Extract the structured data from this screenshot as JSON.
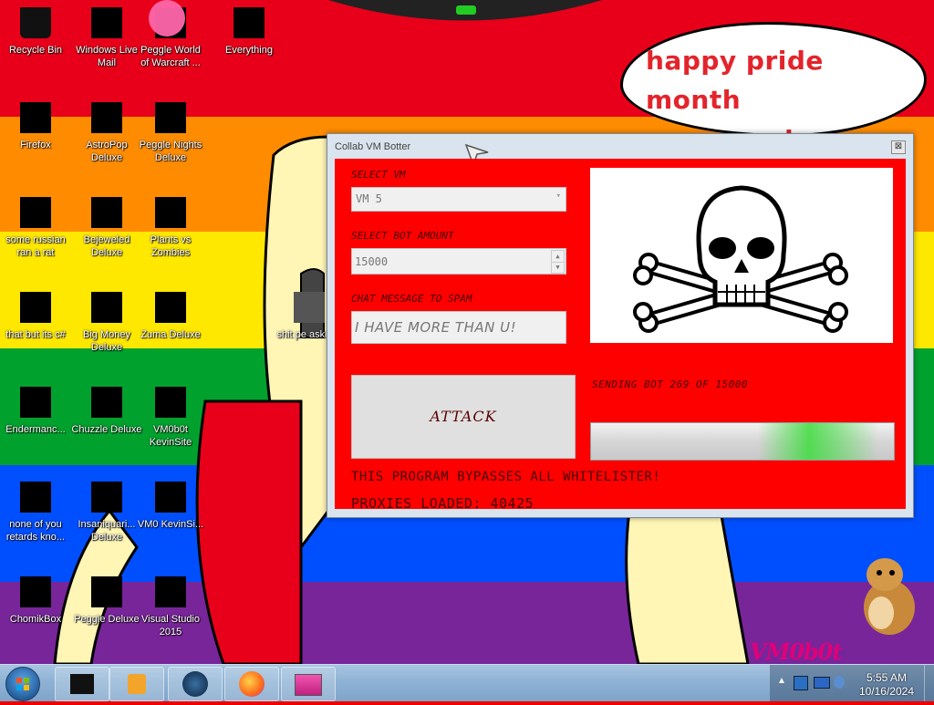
{
  "desktop": {
    "icons": [
      {
        "label": "Recycle Bin"
      },
      {
        "label": "Windows Live Mail"
      },
      {
        "label": "Peggle World of Warcraft ..."
      },
      {
        "label": "Everything"
      },
      {
        "label": "Firefox"
      },
      {
        "label": "AstroPop Deluxe"
      },
      {
        "label": "Peggle Nights Deluxe"
      },
      {
        "label": "some russian ran a rat"
      },
      {
        "label": "Bejeweled Deluxe"
      },
      {
        "label": "Plants vs Zombies"
      },
      {
        "label": "that but its c#"
      },
      {
        "label": "Big Money Deluxe"
      },
      {
        "label": "Zuma Deluxe"
      },
      {
        "label": "Endermanc..."
      },
      {
        "label": "Chuzzle Deluxe"
      },
      {
        "label": "VM0b0t KevinSite"
      },
      {
        "label": "none of you retards kno..."
      },
      {
        "label": "Insaniquari... Deluxe"
      },
      {
        "label": "VM0 KevinSi..."
      },
      {
        "label": "ChomikBox"
      },
      {
        "label": "Peggle Deluxe"
      },
      {
        "label": "Visual Studio 2015"
      },
      {
        "label": "shit pe asked f"
      }
    ],
    "bubble_text": "happy pride month everyone!",
    "logo_text": "VM0b0t"
  },
  "window": {
    "title": "Collab VM Botter",
    "close_glyph": "⊠",
    "select_vm_label": "SELECT VM",
    "select_vm_value": "VM 5",
    "bot_amount_label": "SELECT BOT AMOUNT",
    "bot_amount_value": "15000",
    "chat_label": "CHAT MESSAGE TO SPAM",
    "chat_value": "I HAVE MORE THAN U!",
    "attack_label": "ATTACK",
    "sending_status": "SENDING BOT 269 OF 15000",
    "progress_fraction": 0.018,
    "bypass_text": "THIS PROGRAM BYPASSES ALL WHITELISTER!",
    "proxies_text": "PROXIES LOADED: 40425"
  },
  "taskbar": {
    "time": "5:55 AM",
    "date": "10/16/2024"
  },
  "colors": {
    "rainbow": [
      "#e8001a",
      "#ff8c00",
      "#ffe800",
      "#01a12e",
      "#004fff",
      "#78259a"
    ],
    "window_client": "#ff0000",
    "bubble_text": "#e3242b"
  }
}
